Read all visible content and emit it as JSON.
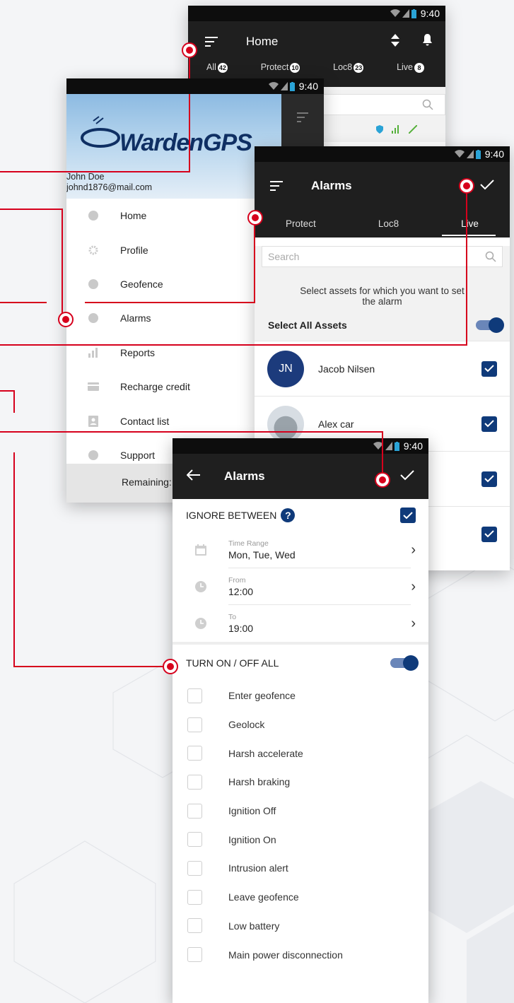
{
  "status_time": "9:40",
  "home_screen": {
    "title": "Home",
    "tabs": [
      {
        "label": "All",
        "count": "42"
      },
      {
        "label": "Protect",
        "count": "10"
      },
      {
        "label": "Loc8",
        "count": "23"
      },
      {
        "label": "Live",
        "count": "8"
      }
    ]
  },
  "drawer_screen": {
    "logo": "WardenGPS",
    "user_name": "John Doe",
    "user_email": "johnd1876@mail.com",
    "menu": [
      {
        "label": "Home",
        "icon": "home-icon"
      },
      {
        "label": "Profile",
        "icon": "gear-icon"
      },
      {
        "label": "Geofence",
        "icon": "geofence-icon"
      },
      {
        "label": "Alarms",
        "icon": "alarm-icon"
      },
      {
        "label": "Reports",
        "icon": "bar-chart-icon"
      },
      {
        "label": "Recharge credit",
        "icon": "card-icon"
      },
      {
        "label": "Contact list",
        "icon": "contact-icon"
      },
      {
        "label": "Support",
        "icon": "support-icon"
      }
    ],
    "footer": "Remaining:"
  },
  "alarms_assets_screen": {
    "title": "Alarms",
    "tabs": [
      "Protect",
      "Loc8",
      "Live"
    ],
    "active_tab": "Live",
    "search_placeholder": "Search",
    "helper_text": "Select assets for which you want to set the alarm",
    "select_all_label": "Select All Assets",
    "assets": [
      {
        "name": "Jacob Nilsen",
        "initials": "JN",
        "checked": true
      },
      {
        "name": "Alex car",
        "initials": "",
        "checked": true
      },
      {
        "name": "",
        "initials": "",
        "checked": true
      },
      {
        "name": "",
        "initials": "",
        "checked": true
      }
    ]
  },
  "alarms_settings_screen": {
    "title": "Alarms",
    "ignore_between_label": "IGNORE BETWEEN",
    "help": "?",
    "time_range_label": "Time Range",
    "time_range_value": "Mon, Tue, Wed",
    "from_label": "From",
    "from_value": "12:00",
    "to_label": "To",
    "to_value": "19:00",
    "turn_on_off_label": "TURN ON / OFF ALL",
    "alarm_types": [
      "Enter geofence",
      "Geolock",
      "Harsh accelerate",
      "Harsh braking",
      "Ignition Off",
      "Ignition On",
      "Intrusion alert",
      "Leave geofence",
      "Low battery",
      "Main power disconnection"
    ]
  },
  "colors": {
    "accent": "#0f3a7a",
    "callout": "#d6001c",
    "appbar": "#1f1f1f"
  }
}
